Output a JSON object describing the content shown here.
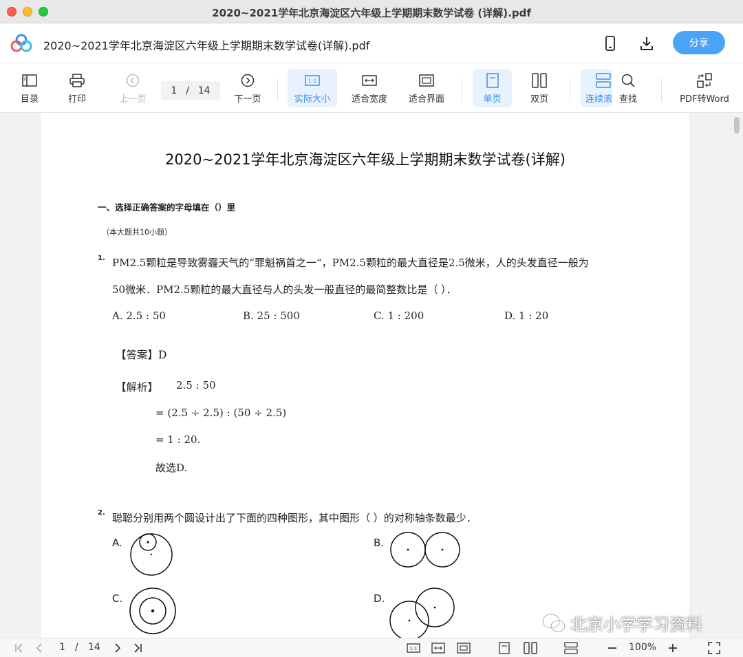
{
  "window": {
    "title": "2020~2021学年北京海淀区六年级上学期期末数学试卷 (详解).pdf"
  },
  "header": {
    "doc_title": "2020~2021学年北京海淀区六年级上学期期末数学试卷(详解).pdf",
    "share_label": "分享",
    "icons": [
      "mobile-icon",
      "download-icon"
    ]
  },
  "toolbar": {
    "toc": "目录",
    "print": "打印",
    "prev": "上一页",
    "page_current": "1",
    "page_sep": "/",
    "page_total": "14",
    "next": "下一页",
    "actual_size": "实际大小",
    "fit_width": "适合宽度",
    "fit_page": "适合界面",
    "single": "单页",
    "double": "双页",
    "continuous": "连续滚",
    "find": "查找",
    "pdf_to_word": "PDF转Word"
  },
  "document": {
    "title": "2020~2021学年北京海淀区六年级上学期期末数学试卷(详解)",
    "section_heading": "一、选择正确答案的字母填在（）里",
    "section_note": "（本大题共10小题）",
    "q1": {
      "num": "1.",
      "line1": "PM2.5颗粒是导致雾霾天气的“罪魁祸首之一“，PM2.5颗粒的最大直径是2.5微米，人的头发直径一般为",
      "line2": "50微米．PM2.5颗粒的最大直径与人的头发一般直径的最简整数比是（    ）．",
      "options": [
        "A. 2.5 : 50",
        "B. 25 : 500",
        "C. 1 : 200",
        "D. 1 : 20"
      ],
      "answer": "【答案】D",
      "analysis_label": "【解析】",
      "analysis_lines": [
        "2.5 : 50",
        "= (2.5 ÷ 2.5) : (50 ÷ 2.5)",
        "= 1 : 20.",
        "故选D."
      ]
    },
    "q2": {
      "num": "2.",
      "text": "聪聪分别用两个圆设计出了下面的四种图形，其中图形（    ）的对称轴条数最少．",
      "labels": [
        "A.",
        "B.",
        "C.",
        "D."
      ]
    }
  },
  "watermark": "北京小学学习资料",
  "bottom": {
    "page_current": "1",
    "page_sep": "/",
    "page_total": "14",
    "zoom": "100%"
  }
}
